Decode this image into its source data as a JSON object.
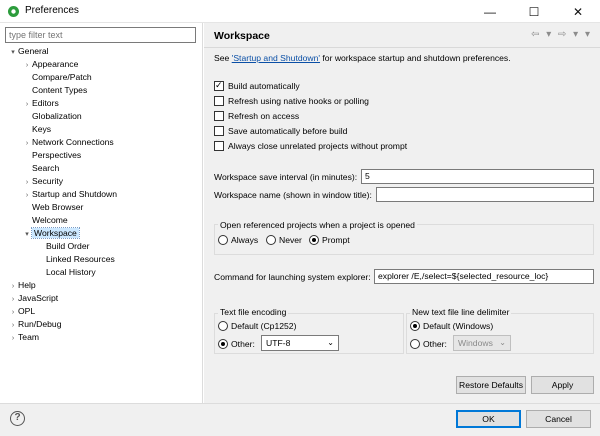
{
  "window": {
    "title": "Preferences",
    "minimize": "—",
    "maximize": "☐",
    "close": "✕"
  },
  "filter": {
    "placeholder": "type filter text"
  },
  "tree": [
    {
      "label": "General",
      "twisty": "▾"
    },
    {
      "label": "Appearance",
      "twisty": "›"
    },
    {
      "label": "Compare/Patch",
      "twisty": ""
    },
    {
      "label": "Content Types",
      "twisty": ""
    },
    {
      "label": "Editors",
      "twisty": "›"
    },
    {
      "label": "Globalization",
      "twisty": ""
    },
    {
      "label": "Keys",
      "twisty": ""
    },
    {
      "label": "Network Connections",
      "twisty": "›"
    },
    {
      "label": "Perspectives",
      "twisty": ""
    },
    {
      "label": "Search",
      "twisty": ""
    },
    {
      "label": "Security",
      "twisty": "›"
    },
    {
      "label": "Startup and Shutdown",
      "twisty": "›"
    },
    {
      "label": "Web Browser",
      "twisty": ""
    },
    {
      "label": "Welcome",
      "twisty": ""
    },
    {
      "label": "Workspace",
      "twisty": "▾"
    },
    {
      "label": "Build Order",
      "twisty": ""
    },
    {
      "label": "Linked Resources",
      "twisty": ""
    },
    {
      "label": "Local History",
      "twisty": ""
    },
    {
      "label": "Help",
      "twisty": "›"
    },
    {
      "label": "JavaScript",
      "twisty": "›"
    },
    {
      "label": "OPL",
      "twisty": "›"
    },
    {
      "label": "Run/Debug",
      "twisty": "›"
    },
    {
      "label": "Team",
      "twisty": "›"
    }
  ],
  "page": {
    "title": "Workspace",
    "nav": "⇦ ▾ ⇨ ▾ ▾",
    "intro_pre": "See ",
    "intro_link": "'Startup and Shutdown'",
    "intro_post": " for workspace startup and shutdown preferences.",
    "checkboxes": [
      {
        "label": "Build automatically",
        "checked": true
      },
      {
        "label": "Refresh using native hooks or polling",
        "checked": false
      },
      {
        "label": "Refresh on access",
        "checked": false
      },
      {
        "label": "Save automatically before build",
        "checked": false
      },
      {
        "label": "Always close unrelated projects without prompt",
        "checked": false
      }
    ],
    "save_interval_label": "Workspace save interval (in minutes):",
    "save_interval_value": "5",
    "workspace_name_label": "Workspace name (shown in window title):",
    "workspace_name_value": "",
    "open_ref_title": "Open referenced projects when a project is opened",
    "open_ref_options": [
      "Always",
      "Never",
      "Prompt"
    ],
    "open_ref_selected": "Prompt",
    "explorer_label": "Command for launching system explorer:",
    "explorer_value": "explorer /E,/select=${selected_resource_loc}",
    "encoding_title": "Text file encoding",
    "encoding_default": "Default (Cp1252)",
    "encoding_other": "Other:",
    "encoding_value": "UTF-8",
    "delimiter_title": "New text file line delimiter",
    "delimiter_default": "Default (Windows)",
    "delimiter_other": "Other:",
    "delimiter_value": "Windows",
    "restore_defaults": "Restore Defaults",
    "apply": "Apply"
  },
  "footer": {
    "help": "?",
    "ok": "OK",
    "cancel": "Cancel"
  }
}
